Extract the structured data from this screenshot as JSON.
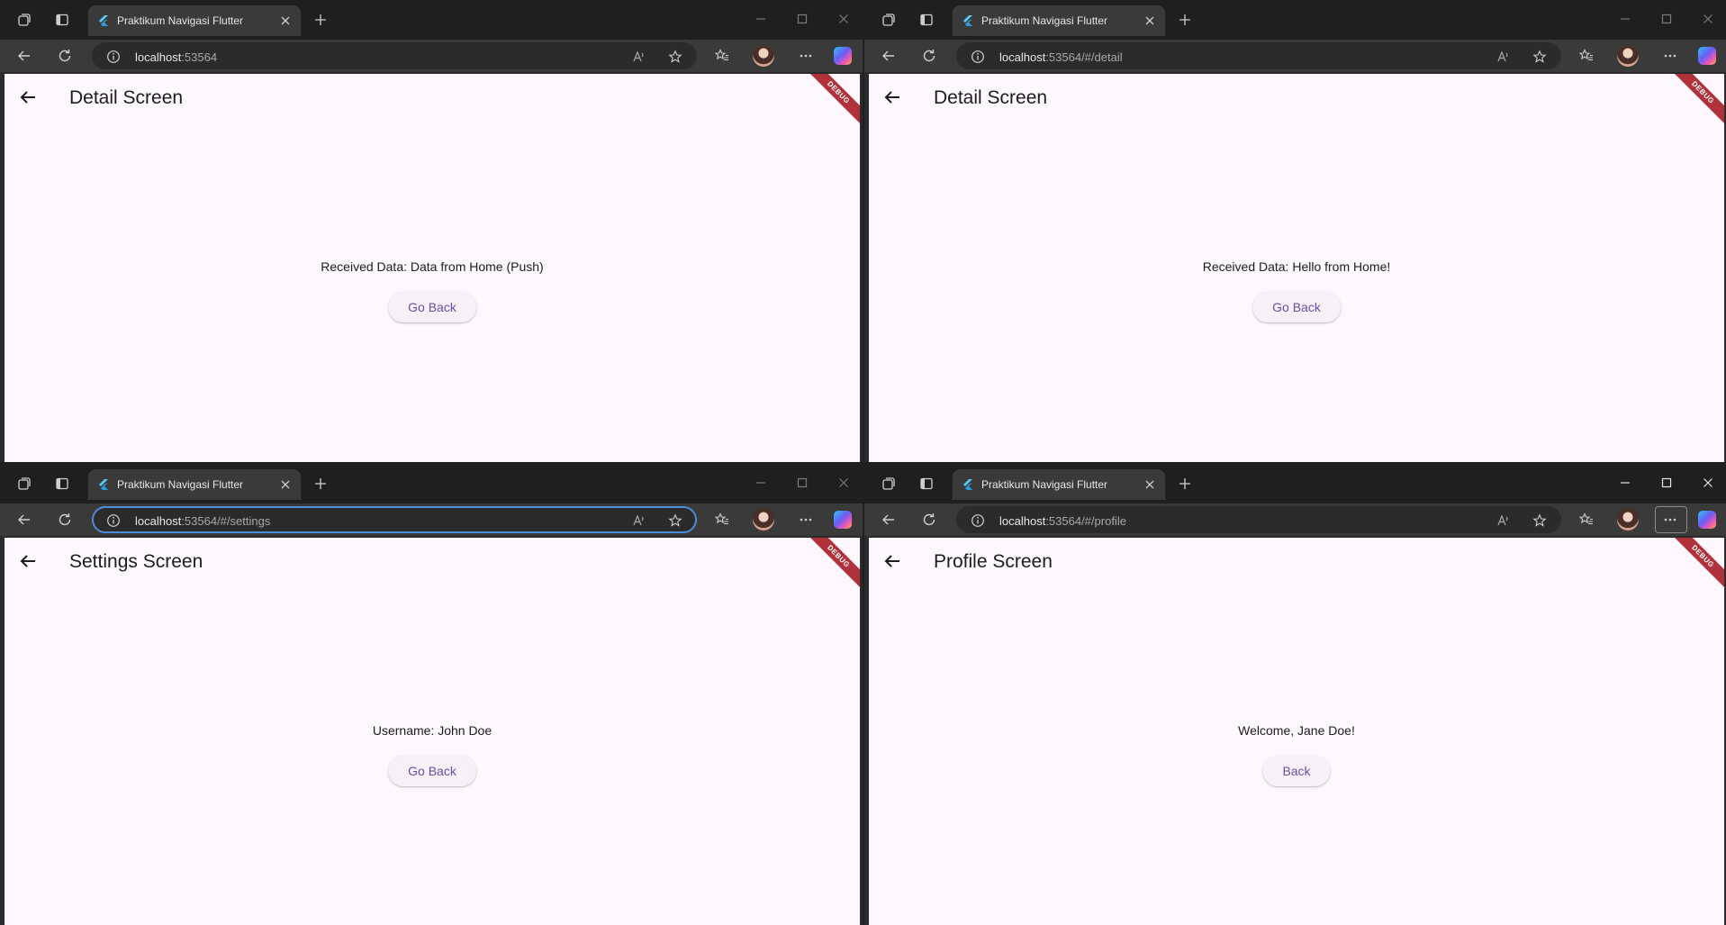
{
  "windows": [
    {
      "tab_title": "Praktikum Navigasi Flutter",
      "url_host": "localhost",
      "url_path": ":53564",
      "screen_title": "Detail Screen",
      "message": "Received Data: Data from Home (Push)",
      "button_label": "Go Back",
      "debug_label": "DEBUG"
    },
    {
      "tab_title": "Praktikum Navigasi Flutter",
      "url_host": "localhost",
      "url_path": ":53564/#/detail",
      "screen_title": "Detail Screen",
      "message": "Received Data: Hello from Home!",
      "button_label": "Go Back",
      "debug_label": "DEBUG"
    },
    {
      "tab_title": "Praktikum Navigasi Flutter",
      "url_host": "localhost",
      "url_path": ":53564/#/settings",
      "screen_title": "Settings Screen",
      "message": "Username: John Doe",
      "button_label": "Go Back",
      "debug_label": "DEBUG"
    },
    {
      "tab_title": "Praktikum Navigasi Flutter",
      "url_host": "localhost",
      "url_path": ":53564/#/profile",
      "screen_title": "Profile Screen",
      "message": "Welcome, Jane Doe!",
      "button_label": "Back",
      "debug_label": "DEBUG"
    }
  ],
  "icons": {
    "collections": "collections-icon",
    "tab_actions": "tab-actions-icon",
    "favicon": "flutter-logo-icon",
    "close_tab": "close-icon",
    "new_tab": "plus-icon",
    "back": "arrow-left-icon",
    "reload": "reload-icon",
    "site_info": "info-icon",
    "read_aloud": "read-aloud-icon",
    "add_favorite": "star-icon",
    "favorites": "favorites-icon",
    "more": "more-icon",
    "copilot": "copilot-icon"
  },
  "colors": {
    "app_background": "#fef7fe",
    "button_text": "#6750a4",
    "debug_banner": "#b0313a",
    "focus_ring": "#4c8ddb"
  }
}
